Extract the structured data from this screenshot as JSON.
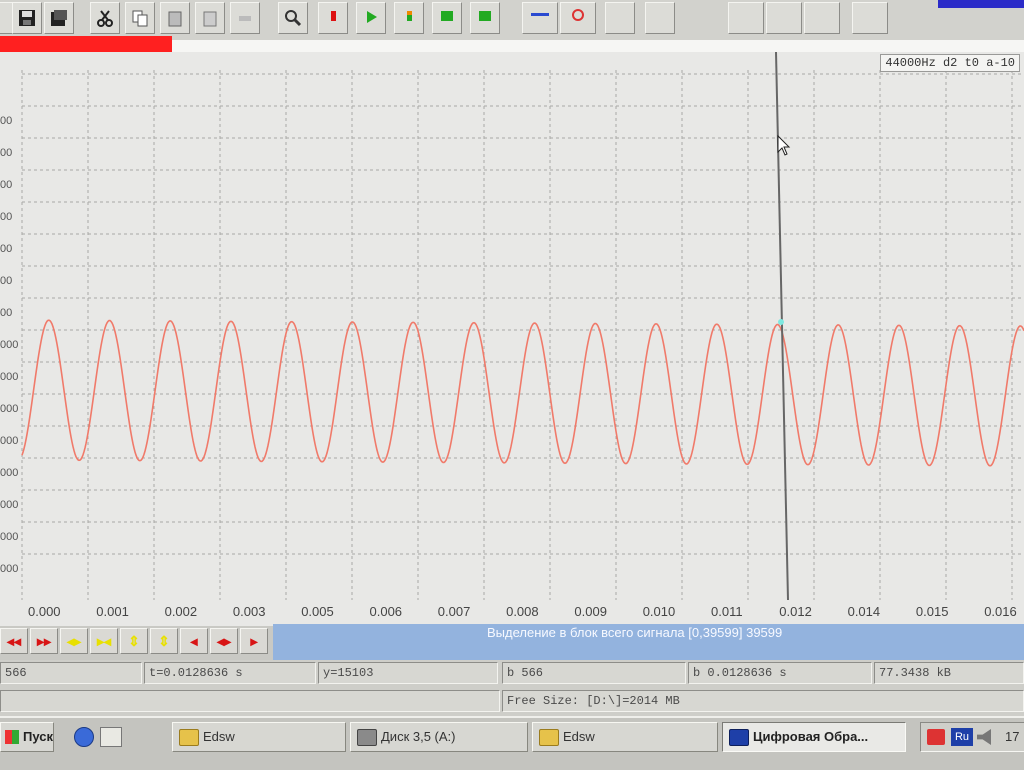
{
  "plot": {
    "tag": "44000Hz d2 t0 a-10",
    "y_tick_labels": [
      "00",
      "00",
      "00",
      "00",
      "00",
      "00",
      "00",
      "000",
      "000",
      "000",
      "000",
      "000",
      "000",
      "000",
      "000"
    ],
    "x_tick_labels": [
      "0.000",
      "0.001",
      "0.002",
      "0.003",
      "0.005",
      "0.006",
      "0.007",
      "0.008",
      "0.009",
      "0.010",
      "0.011",
      "0.012",
      "0.014",
      "0.015",
      "0.016"
    ],
    "wave_color": "#f07a6a",
    "grid_color": "#a9a9a6",
    "cursor_color": "#666666",
    "cycles_visible": 16.5
  },
  "nav": {
    "buttons": [
      {
        "icon": "rewind-icon",
        "glyph": "◂◂",
        "color": "#d81515"
      },
      {
        "icon": "fast-forward-icon",
        "glyph": "▸▸",
        "color": "#d81515"
      },
      {
        "icon": "expand-horizontal-icon",
        "glyph": "◂▸",
        "color": "#e8e000"
      },
      {
        "icon": "shrink-horizontal-icon",
        "glyph": "▸◂",
        "color": "#e8e000"
      },
      {
        "icon": "expand-vertical-icon",
        "glyph": "⇕",
        "color": "#e8e000"
      },
      {
        "icon": "shrink-vertical-icon",
        "glyph": "⇕",
        "color": "#e8e000"
      },
      {
        "icon": "scroll-left-icon",
        "glyph": "◂",
        "color": "#d81515"
      },
      {
        "icon": "scroll-center-icon",
        "glyph": "◂▸",
        "color": "#d81515"
      },
      {
        "icon": "scroll-right-icon",
        "glyph": "▸",
        "color": "#d81515"
      }
    ],
    "selection_text": "Выделение в блок всего сигнала [0,39599] 39599"
  },
  "status": {
    "f1": "566",
    "f2": "t=0.0128636 s",
    "f3": "y=15103",
    "f4": "b 566",
    "f5": "b 0.0128636 s",
    "f6": "77.3438 kB",
    "free_size": "Free Size: [D:\\]=2014 MB"
  },
  "taskbar": {
    "start_label": "Пуск",
    "tasks": [
      {
        "label": "Edsw",
        "icon": "folder-icon"
      },
      {
        "label": "Диск 3,5 (A:)",
        "icon": "floppy-icon"
      },
      {
        "label": "Edsw",
        "icon": "folder-icon"
      },
      {
        "label": "Цифровая Обра...",
        "icon": "app-icon"
      }
    ],
    "tray_lang": "Ru",
    "tray_time": "17"
  },
  "toolbar": {
    "icons": [
      "save-icon",
      "save-as-icon",
      "cut-icon",
      "copy-icon",
      "paste-icon",
      "paste-special-icon",
      "undo-icon",
      "zoom-icon",
      "stop-icon",
      "play-icon",
      "record-icon",
      "play-selection-icon",
      "loop-icon",
      "waveform-icon",
      "spectrum-icon",
      "marker-icon",
      "settings-icon",
      "info-icon",
      "help-icon"
    ]
  }
}
